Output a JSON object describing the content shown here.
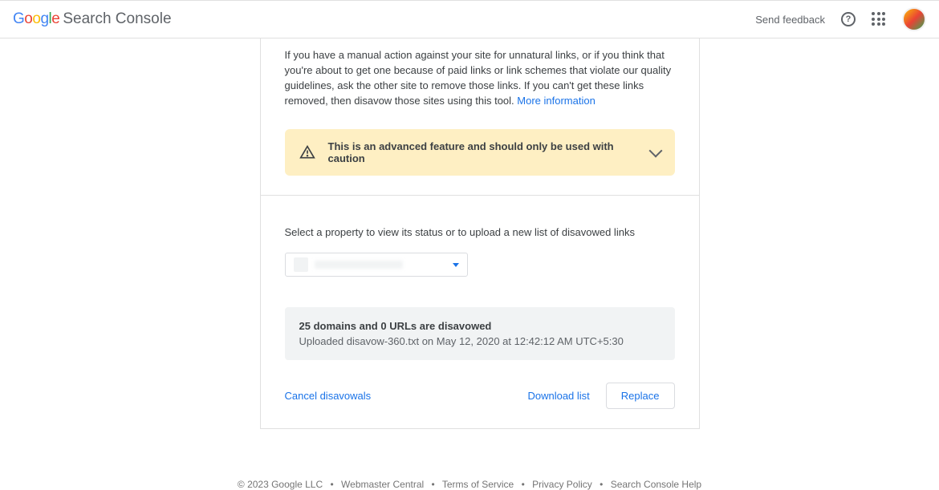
{
  "header": {
    "logo_suffix": "Search Console",
    "feedback": "Send feedback"
  },
  "intro": {
    "text": "If you have a manual action against your site for unnatural links, or if you think that you're about to get one because of paid links or link schemes that violate our quality guidelines, ask the other site to remove those links. If you can't get these links removed, then disavow those sites using this tool. ",
    "more_info": "More information"
  },
  "warning": {
    "text": "This is an advanced feature and should only be used with caution"
  },
  "section": {
    "select_label": "Select a property to view its status or to upload a new list of disavowed links",
    "status_title": "25 domains and 0 URLs are disavowed",
    "status_sub": "Uploaded disavow-360.txt on May 12, 2020 at 12:42:12 AM UTC+5:30"
  },
  "actions": {
    "cancel": "Cancel disavowals",
    "download": "Download list",
    "replace": "Replace"
  },
  "footer": {
    "copyright": "© 2023 Google LLC",
    "links": [
      "Webmaster Central",
      "Terms of Service",
      "Privacy Policy",
      "Search Console Help"
    ]
  }
}
